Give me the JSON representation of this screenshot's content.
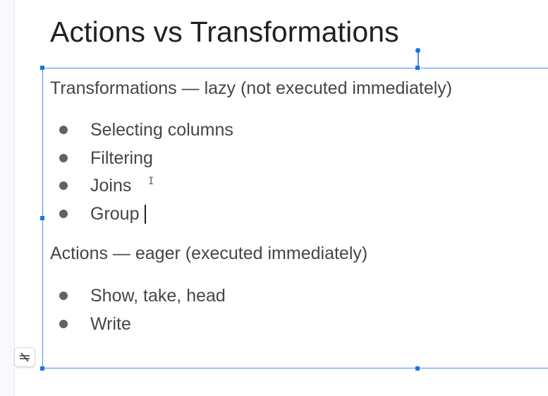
{
  "slide": {
    "title": "Actions vs Transformations"
  },
  "content": {
    "transformations": {
      "heading": "Transformations — lazy (not executed immediately)",
      "items": [
        "Selecting columns",
        "Filtering",
        "Joins",
        "Group"
      ]
    },
    "actions": {
      "heading": "Actions — eager (executed immediately)",
      "items": [
        "Show, take, head",
        "Write"
      ]
    }
  },
  "icons": {
    "format_button": "text-autofit-off-icon",
    "pointer": "i-beam-cursor-icon"
  },
  "colors": {
    "selection": "#4f8df5",
    "handle": "#1a73e8",
    "title": "#202124",
    "body_text": "#444746"
  }
}
